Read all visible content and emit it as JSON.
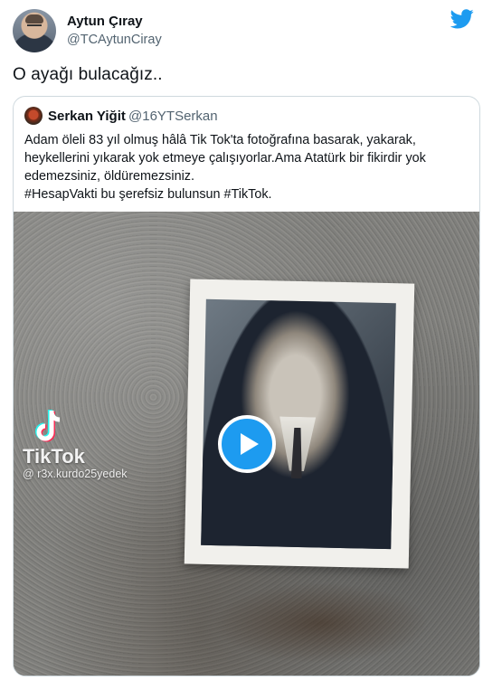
{
  "author": {
    "name": "Aytun Çıray",
    "handle": "@TCAytunCiray"
  },
  "tweet": {
    "text": "O ayağı bulacağız.."
  },
  "quoted": {
    "name": "Serkan Yiğit",
    "handle": "@16YTSerkan",
    "text_lines": [
      "Adam öleli 83 yıl olmuş hâlâ Tik Tok'ta fotoğrafına basarak, yakarak,",
      "heykellerini yıkarak yok etmeye çalışıyorlar.Ama Atatürk bir fikirdir yok",
      "edemezsiniz, öldüremezsiniz.",
      "#HesapVakti bu şerefsiz bulunsun #TikTok."
    ],
    "video": {
      "watermark_brand": "TikTok",
      "watermark_user": "@ r3x.kurdo25yedek"
    }
  },
  "colors": {
    "accent": "#1d9bf0",
    "muted": "#536471",
    "border": "#cfd9de"
  },
  "icons": [
    "twitter-bird-icon",
    "play-icon",
    "tiktok-logo-icon"
  ]
}
